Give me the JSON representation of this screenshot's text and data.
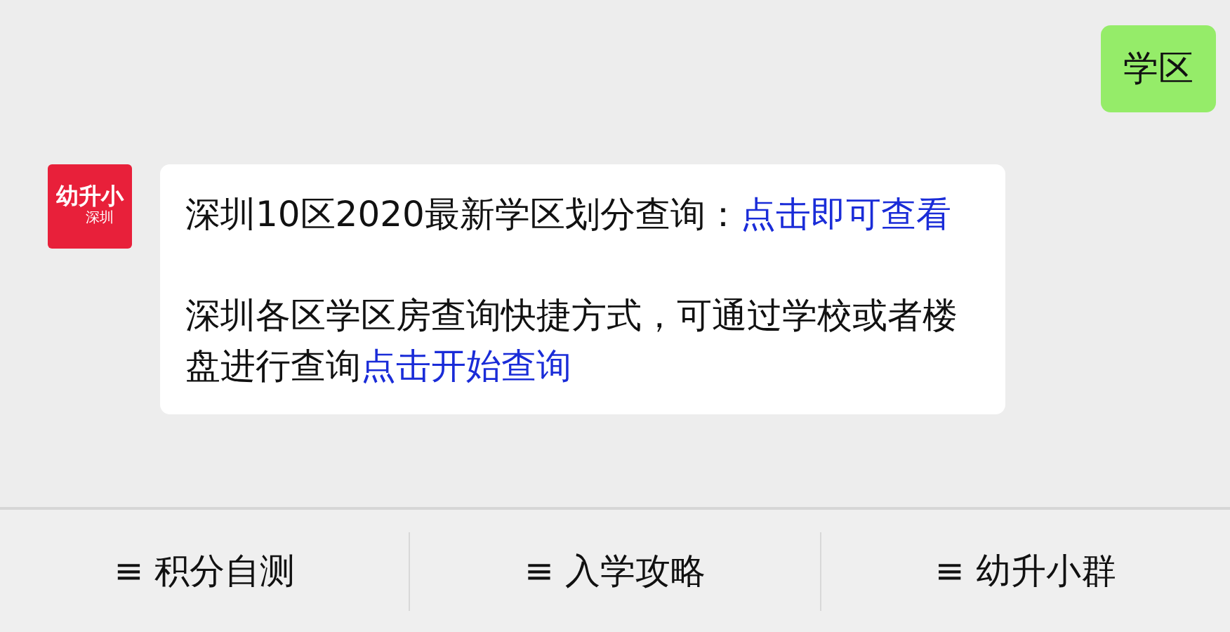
{
  "sent_message": {
    "text": "学区"
  },
  "reply": {
    "logo": {
      "title": "幼升小",
      "subtitle": "深圳"
    },
    "paragraphs": [
      {
        "text": "深圳10区2020最新学区划分查询：",
        "link": "点击即可查看"
      },
      {
        "text": "深圳各区学区房查询快捷方式，可通过学校或者楼盘进行查询",
        "link": "点击开始查询"
      }
    ]
  },
  "menu": [
    {
      "icon": "≡",
      "label": "积分自测"
    },
    {
      "icon": "≡",
      "label": "入学攻略"
    },
    {
      "icon": "≡",
      "label": "幼升小群"
    }
  ]
}
